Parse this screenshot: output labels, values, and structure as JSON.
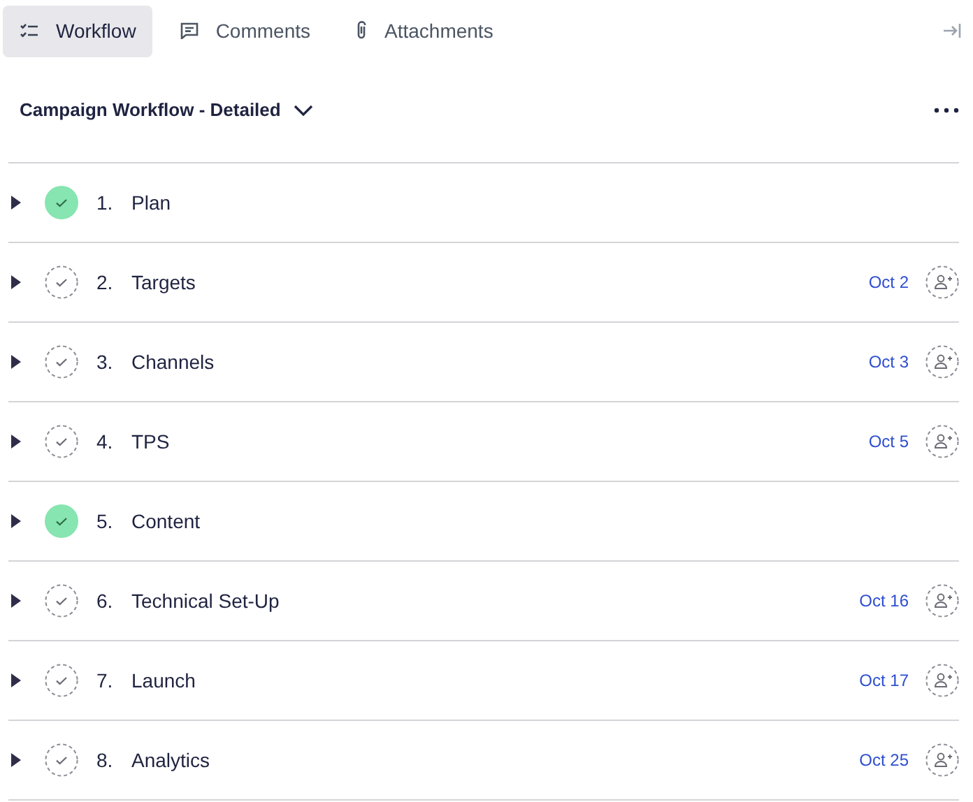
{
  "tabs": [
    {
      "label": "Workflow",
      "selected": true
    },
    {
      "label": "Comments",
      "selected": false
    },
    {
      "label": "Attachments",
      "selected": false
    }
  ],
  "workflow": {
    "title": "Campaign Workflow - Detailed"
  },
  "steps": [
    {
      "number": "1.",
      "name": "Plan",
      "done": true
    },
    {
      "number": "2.",
      "name": "Targets",
      "done": false,
      "due": "Oct 2"
    },
    {
      "number": "3.",
      "name": "Channels",
      "done": false,
      "due": "Oct 3"
    },
    {
      "number": "4.",
      "name": "TPS",
      "done": false,
      "due": "Oct 5"
    },
    {
      "number": "5.",
      "name": "Content",
      "done": true
    },
    {
      "number": "6.",
      "name": "Technical Set-Up",
      "done": false,
      "due": "Oct 16"
    },
    {
      "number": "7.",
      "name": "Launch",
      "done": false,
      "due": "Oct 17"
    },
    {
      "number": "8.",
      "name": "Analytics",
      "done": false,
      "due": "Oct 25"
    }
  ]
}
